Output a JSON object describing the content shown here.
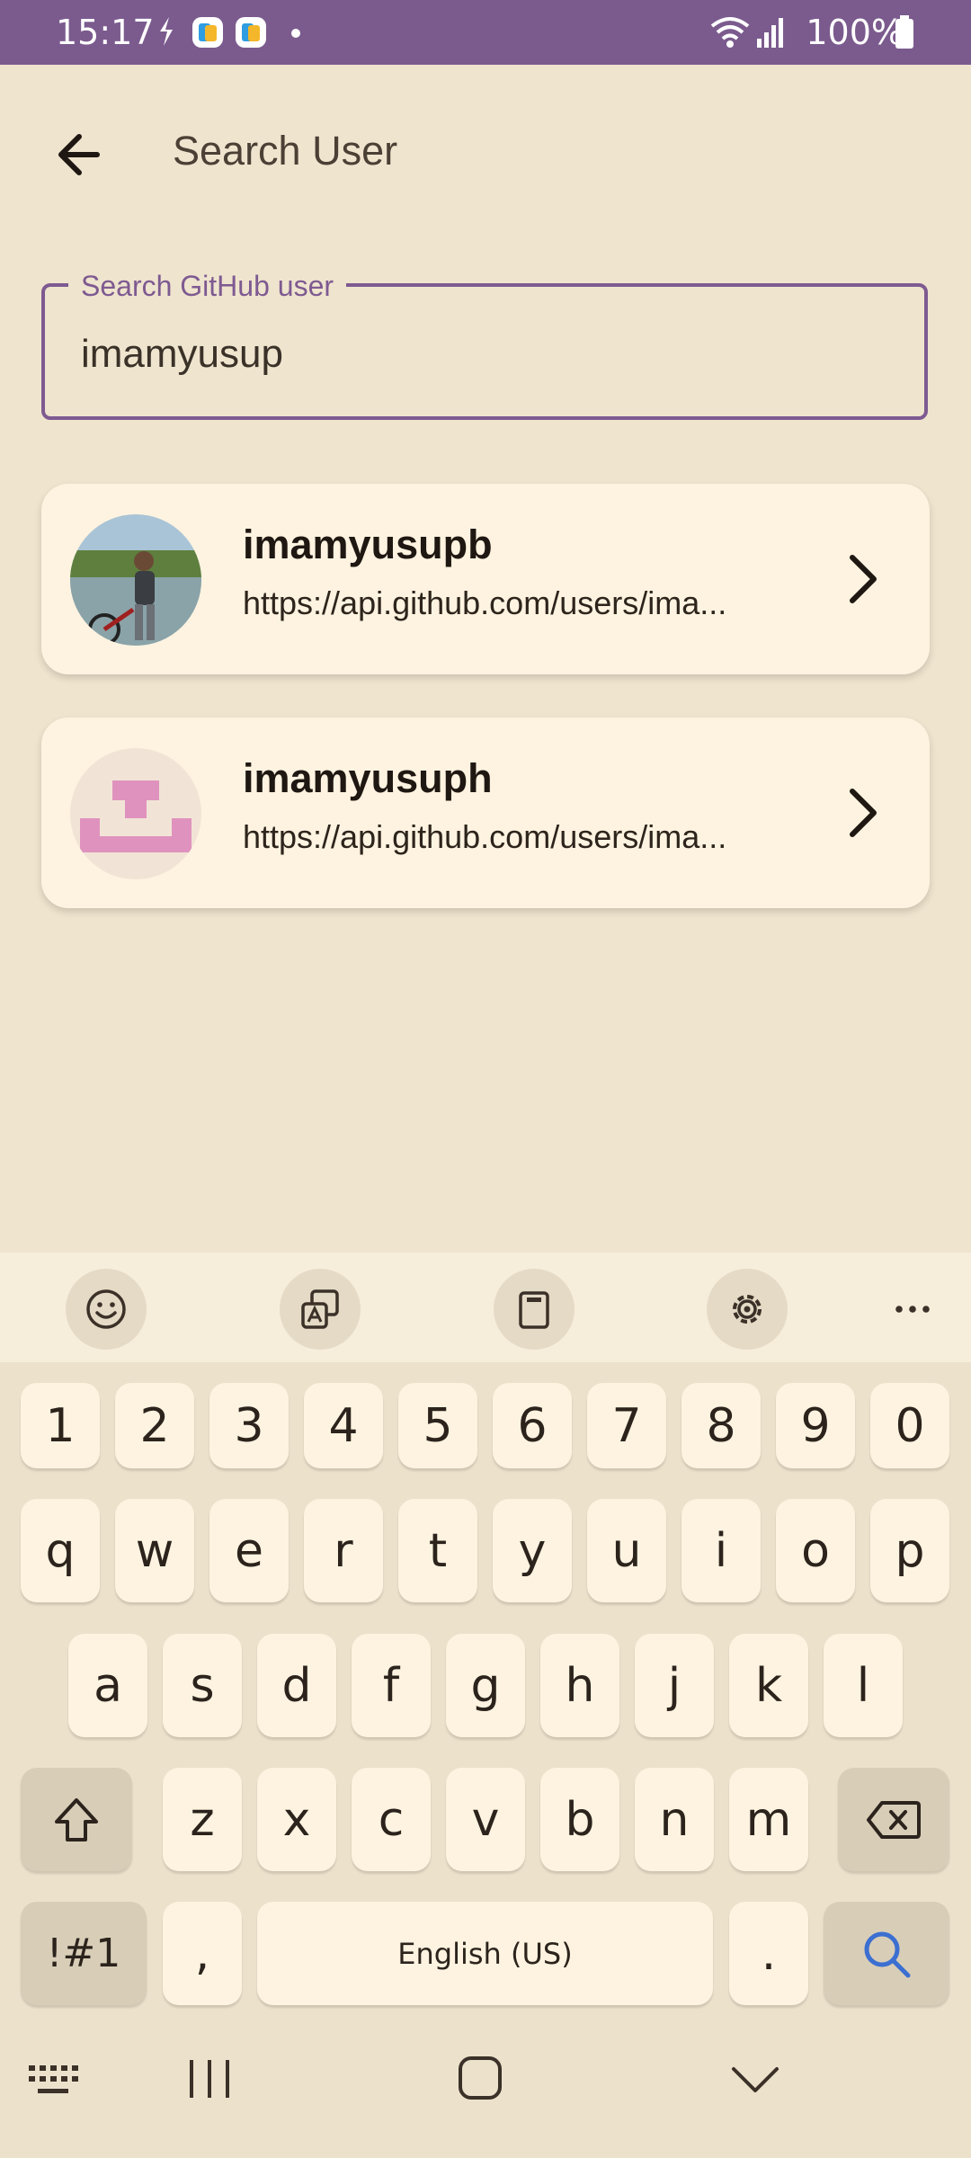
{
  "status_bar": {
    "time": "15:17",
    "battery": "100%"
  },
  "header": {
    "title": "Search User"
  },
  "search": {
    "label": "Search GitHub user",
    "value": "imamyusup"
  },
  "results": [
    {
      "username": "imamyusupb",
      "url": "https://api.github.com/users/ima..."
    },
    {
      "username": "imamyusuph",
      "url": "https://api.github.com/users/ima..."
    }
  ],
  "keyboard": {
    "row_numbers": [
      "1",
      "2",
      "3",
      "4",
      "5",
      "6",
      "7",
      "8",
      "9",
      "0"
    ],
    "row_top": [
      "q",
      "w",
      "e",
      "r",
      "t",
      "y",
      "u",
      "i",
      "o",
      "p"
    ],
    "row_middle": [
      "a",
      "s",
      "d",
      "f",
      "g",
      "h",
      "j",
      "k",
      "l"
    ],
    "row_bottom": [
      "z",
      "x",
      "c",
      "v",
      "b",
      "n",
      "m"
    ],
    "symbols_label": "!#1",
    "comma": ",",
    "space_label": "English (US)",
    "period": "."
  },
  "colors": {
    "accent": "#7E5A91",
    "status_bar": "#7B5B8E",
    "background": "#EFE4CE",
    "card": "#FEF3E0"
  }
}
